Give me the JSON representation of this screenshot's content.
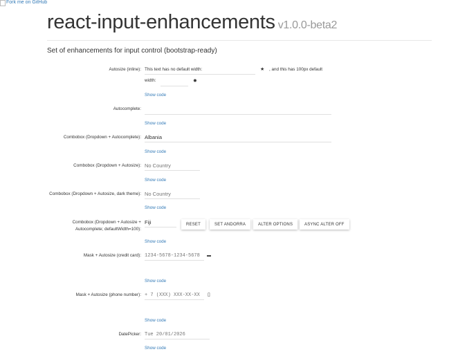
{
  "fork_link": "Fork me on GitHub",
  "header": {
    "title": "react-input-enhancements",
    "version": "v1.0.0-beta2",
    "subtitle": "Set of enhancements for input control (bootstrap-ready)"
  },
  "show_code": "Show code",
  "autosize": {
    "label": "Autosize (inline):",
    "value1": "This text has no default width:",
    "icon1": "star-icon",
    "text2": ", and this has 100px default",
    "text3": "width:",
    "icon2": "sun-icon"
  },
  "autocomplete": {
    "label": "Autocomplete:",
    "value": ""
  },
  "combobox1": {
    "label": "Combobox (Dropdown + Autocomplete):",
    "value": "Albania"
  },
  "combobox2": {
    "label": "Combobox (Dropdown + Autosize):",
    "placeholder": "No Country"
  },
  "combobox3": {
    "label": "Combobox (Dropdown + Autosize, dark theme):",
    "placeholder": "No Country"
  },
  "combobox4": {
    "label": "Combobox (Dropdown + Autosize + Autocomplete; defaultWidth=100):",
    "value": "Fiji",
    "buttons": [
      "RESET",
      "SET ANDORRA",
      "ALTER OPTIONS",
      "ASYNC ALTER OFF"
    ]
  },
  "mask_cc": {
    "label": "Mask + Autosize (credit card):",
    "placeholder": "1234-5678-1234-5678",
    "icon": "credit-card-icon"
  },
  "mask_phone": {
    "label": "Mask + Autosize (phone number):",
    "placeholder": "+ 7 (XXX) XXX-XX-XX",
    "icon": "mobile-phone-icon"
  },
  "datepicker": {
    "label": "DatePicker:",
    "placeholder": "Tue 20/01/2026"
  }
}
